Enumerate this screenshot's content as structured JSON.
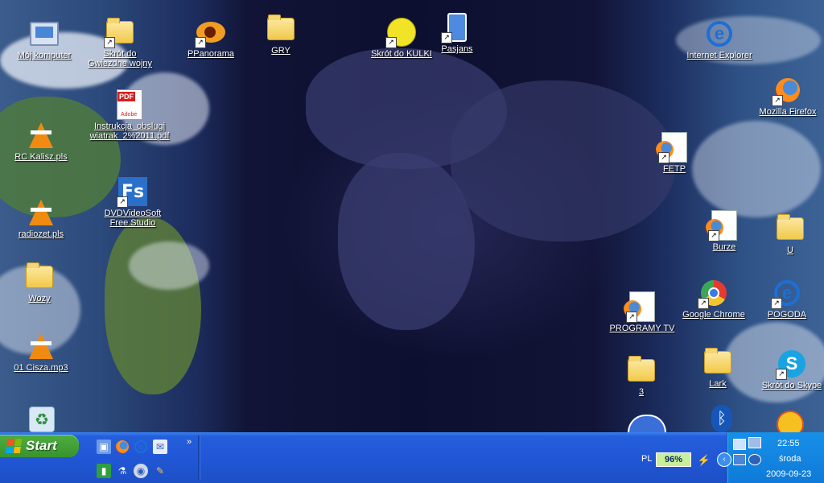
{
  "desktop": {
    "icons": [
      {
        "label": "Mój komputer"
      },
      {
        "label": "Skrót do Gwiezdne wojny"
      },
      {
        "label": "PPanorama"
      },
      {
        "label": "GRY"
      },
      {
        "label": "Skrót do KULKI"
      },
      {
        "label": "Pasjans"
      },
      {
        "label": "Internet Explorer"
      },
      {
        "label": "Mozilla Firefox"
      },
      {
        "label": "Instrukcja_obslugi wiatrak_2%2011.pdf"
      },
      {
        "label": "RC Kalisz.pls"
      },
      {
        "label": "DVDVideoSoft Free Studio"
      },
      {
        "label": "FETP"
      },
      {
        "label": "radiozet.pls"
      },
      {
        "label": "Burze"
      },
      {
        "label": "U"
      },
      {
        "label": "Wozy"
      },
      {
        "label": "Google Chrome"
      },
      {
        "label": "POGODA"
      },
      {
        "label": "PROGRAMY TV"
      },
      {
        "label": "01 Cisza.mp3"
      },
      {
        "label": "Lark"
      },
      {
        "label": "3"
      },
      {
        "label": "Skrót do Skype"
      }
    ],
    "pdf_tag": "PDF",
    "pdf_brand": "Adobe",
    "fs_text": "Fs",
    "ie_glyph": "e",
    "skype_glyph": "S",
    "bt_glyph": "ᛒ"
  },
  "taskbar": {
    "start_label": "Start",
    "quicklaunch_more": "»",
    "language": "PL",
    "battery": "96%",
    "time": "22:55",
    "day": "środa",
    "date": "2009-09-23"
  }
}
